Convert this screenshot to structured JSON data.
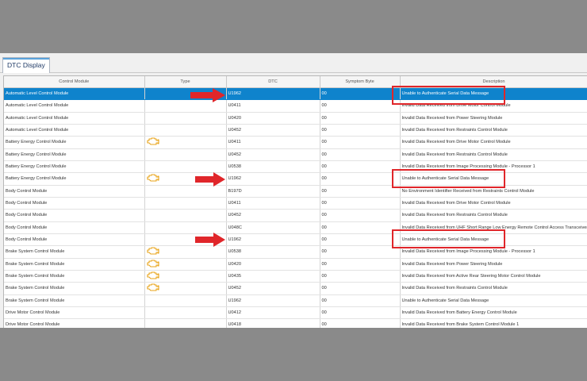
{
  "tab": {
    "label": "DTC Display"
  },
  "table": {
    "columns": [
      "Control Module",
      "Type",
      "DTC",
      "Symptom Byte",
      "Description"
    ],
    "rows": [
      {
        "module": "Automatic Level Control Module",
        "warn": false,
        "dtc": "U1962",
        "symptom": "00",
        "desc": "Unable to Authenticate Serial Data Message",
        "selected": true
      },
      {
        "module": "Automatic Level Control Module",
        "warn": false,
        "dtc": "U0411",
        "symptom": "00",
        "desc": "Invalid Data Received from Drive Motor Control Module",
        "selected": false
      },
      {
        "module": "Automatic Level Control Module",
        "warn": false,
        "dtc": "U0420",
        "symptom": "00",
        "desc": "Invalid Data Received from Power Steering Module",
        "selected": false
      },
      {
        "module": "Automatic Level Control Module",
        "warn": false,
        "dtc": "U0452",
        "symptom": "00",
        "desc": "Invalid Data Received from Restraints Control Module",
        "selected": false
      },
      {
        "module": "Battery Energy Control Module",
        "warn": true,
        "dtc": "U0411",
        "symptom": "00",
        "desc": "Invalid Data Received from Drive Motor Control Module",
        "selected": false
      },
      {
        "module": "Battery Energy Control Module",
        "warn": false,
        "dtc": "U0452",
        "symptom": "00",
        "desc": "Invalid Data Received from Restraints Control Module",
        "selected": false
      },
      {
        "module": "Battery Energy Control Module",
        "warn": false,
        "dtc": "U0538",
        "symptom": "00",
        "desc": "Invalid Data Received from Image Processing Module - Processor 1",
        "selected": false
      },
      {
        "module": "Battery Energy Control Module",
        "warn": true,
        "dtc": "U1962",
        "symptom": "00",
        "desc": "Unable to Authenticate Serial Data Message",
        "selected": false
      },
      {
        "module": "Body Control Module",
        "warn": false,
        "dtc": "B197D",
        "symptom": "00",
        "desc": "No Environment Identifier Received from Restraints Control Module",
        "selected": false
      },
      {
        "module": "Body Control Module",
        "warn": false,
        "dtc": "U0411",
        "symptom": "00",
        "desc": "Invalid Data Received from Drive Motor Control Module",
        "selected": false
      },
      {
        "module": "Body Control Module",
        "warn": false,
        "dtc": "U0452",
        "symptom": "00",
        "desc": "Invalid Data Received from Restraints Control Module",
        "selected": false
      },
      {
        "module": "Body Control Module",
        "warn": false,
        "dtc": "U048C",
        "symptom": "00",
        "desc": "Invalid Data Received from UHF Short Range Low Energy Remote Control Access Transceiver",
        "selected": false
      },
      {
        "module": "Body Control Module",
        "warn": false,
        "dtc": "U1962",
        "symptom": "00",
        "desc": "Unable to Authenticate Serial Data Message",
        "selected": false
      },
      {
        "module": "Brake System Control Module",
        "warn": true,
        "dtc": "U0538",
        "symptom": "00",
        "desc": "Invalid Data Received from Image Processing Module - Processor 1",
        "selected": false
      },
      {
        "module": "Brake System Control Module",
        "warn": true,
        "dtc": "U0420",
        "symptom": "00",
        "desc": "Invalid Data Received from Power Steering Module",
        "selected": false
      },
      {
        "module": "Brake System Control Module",
        "warn": true,
        "dtc": "U0435",
        "symptom": "00",
        "desc": "Invalid Data Received from Active Rear Steering Motor Control Module",
        "selected": false
      },
      {
        "module": "Brake System Control Module",
        "warn": true,
        "dtc": "U0452",
        "symptom": "00",
        "desc": "Invalid Data Received from Restraints Control Module",
        "selected": false
      },
      {
        "module": "Brake System Control Module",
        "warn": false,
        "dtc": "U1962",
        "symptom": "00",
        "desc": "Unable to Authenticate Serial Data Message",
        "selected": false
      },
      {
        "module": "Drive Motor Control Module",
        "warn": false,
        "dtc": "U0412",
        "symptom": "00",
        "desc": "Invalid Data Received from Battery Energy Control Module",
        "selected": false
      },
      {
        "module": "Drive Motor Control Module",
        "warn": false,
        "dtc": "U0418",
        "symptom": "00",
        "desc": "Invalid Data Received from Brake System Control Module 1",
        "selected": false
      }
    ]
  },
  "annotations": {
    "highlight_color": "#e0262a",
    "selection_color": "#0f83cc",
    "warning_icon_color": "#e8a317",
    "warning_icon": "engine-warning-icon",
    "arrow_icon": "red-arrow-icon"
  }
}
